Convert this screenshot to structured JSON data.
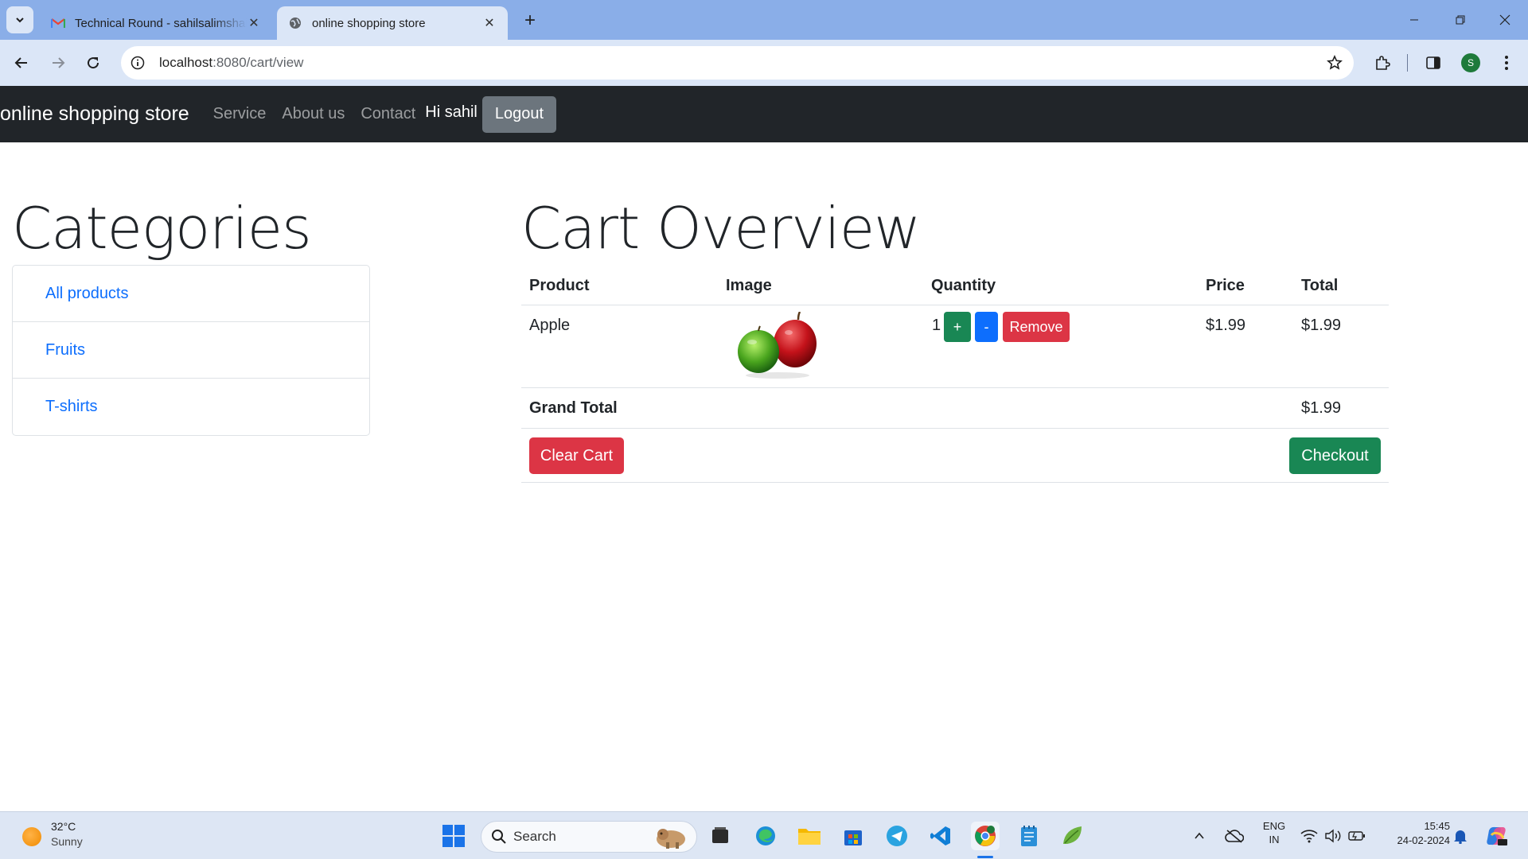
{
  "browser": {
    "tabs": [
      {
        "title": "Technical Round - sahilsalimshaikh",
        "active": false,
        "favicon": "gmail-icon"
      },
      {
        "title": "online shopping store",
        "active": true,
        "favicon": "globe-icon"
      }
    ],
    "address": {
      "host": "localhost",
      "path": ":8080/cart/view"
    },
    "profile_initial": "S"
  },
  "navbar": {
    "brand": "online shopping store",
    "links": [
      "Service",
      "About us",
      "Contact"
    ],
    "greeting": "Hi sahil",
    "logout_label": "Logout"
  },
  "categories": {
    "heading": "Categories",
    "items": [
      "All products",
      "Fruits",
      "T-shirts"
    ]
  },
  "cart": {
    "heading": "Cart Overview",
    "columns": [
      "Product",
      "Image",
      "Quantity",
      "Price",
      "Total"
    ],
    "items": [
      {
        "product": "Apple",
        "image": "apple-image",
        "quantity": "1",
        "price": "$1.99",
        "total": "$1.99"
      }
    ],
    "buttons": {
      "plus": "+",
      "minus": "-",
      "remove": "Remove",
      "clear": "Clear Cart",
      "checkout": "Checkout"
    },
    "grand_total_label": "Grand Total",
    "grand_total": "$1.99"
  },
  "taskbar": {
    "weather_temp": "32°C",
    "weather_desc": "Sunny",
    "search_label": "Search",
    "lang_top": "ENG",
    "lang_bottom": "IN",
    "time": "15:45",
    "date": "24-02-2024"
  },
  "colors": {
    "navbar_bg": "#212529",
    "link": "#0d6efd",
    "success": "#198754",
    "danger": "#dc3545",
    "secondary": "#6c757d"
  }
}
